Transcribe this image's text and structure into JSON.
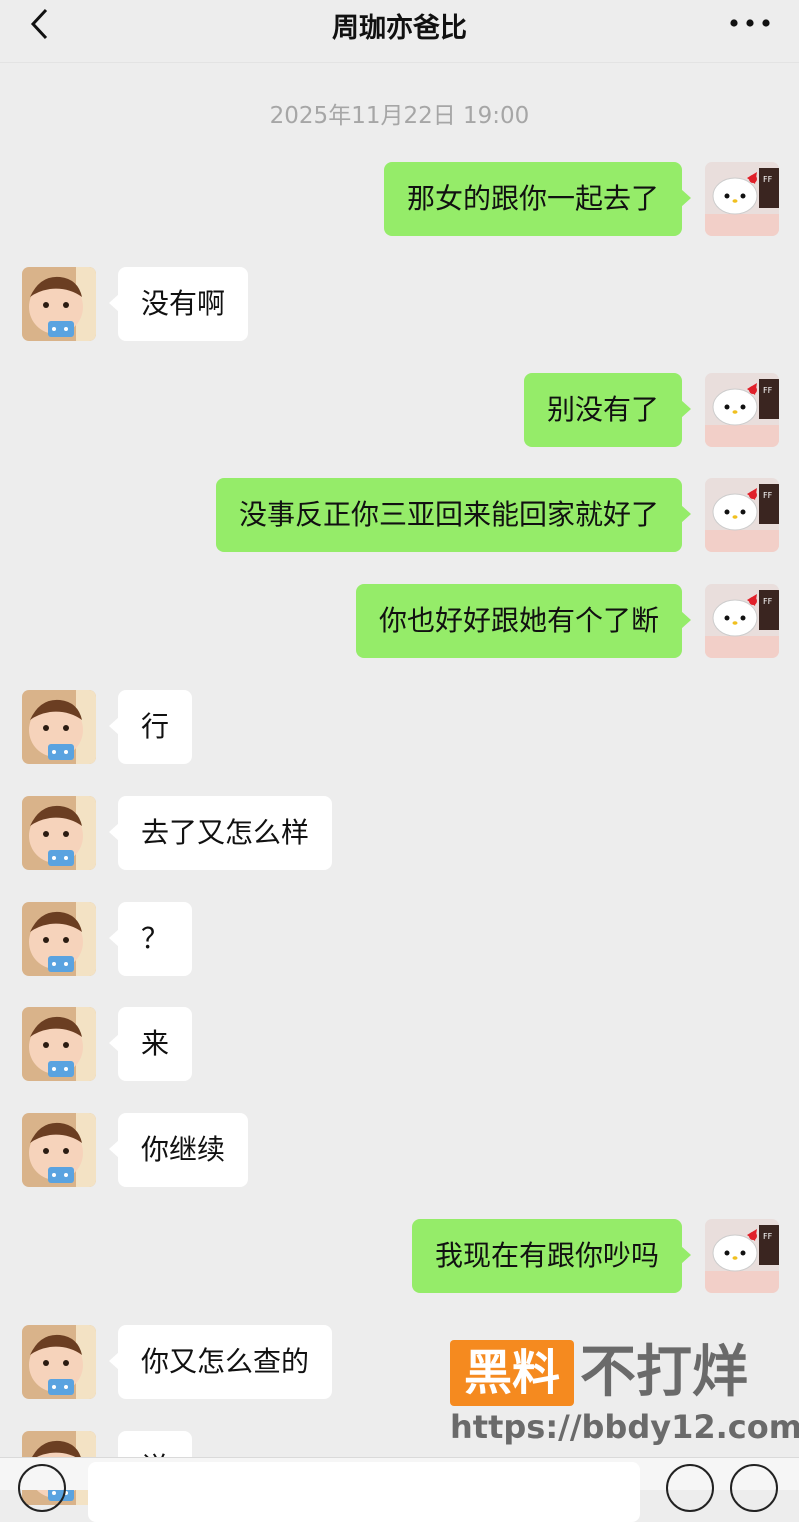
{
  "header": {
    "title": "周珈亦爸比"
  },
  "chat": {
    "timestamp": "2025年11月22日 19:00",
    "messages": [
      {
        "side": "out",
        "text": "那女的跟你一起去了"
      },
      {
        "side": "in",
        "text": "没有啊"
      },
      {
        "side": "out",
        "text": "别没有了"
      },
      {
        "side": "out",
        "text": "没事反正你三亚回来能回家就好了"
      },
      {
        "side": "out",
        "text": "你也好好跟她有个了断"
      },
      {
        "side": "in",
        "text": "行"
      },
      {
        "side": "in",
        "text": "去了又怎么样"
      },
      {
        "side": "in",
        "text": "？"
      },
      {
        "side": "in",
        "text": "来"
      },
      {
        "side": "in",
        "text": "你继续"
      },
      {
        "side": "out",
        "text": "我现在有跟你吵吗"
      },
      {
        "side": "in",
        "text": "你又怎么查的"
      },
      {
        "side": "in",
        "text": "说"
      }
    ]
  },
  "watermark": {
    "badge": "黑料",
    "text": "不打烊",
    "url": "https://bbdy12.com"
  },
  "colors": {
    "out_bubble": "#95ec69",
    "in_bubble": "#ffffff",
    "background": "#ededed"
  },
  "icons": {
    "back": "chevron-left-icon",
    "more": "more-dots-icon"
  }
}
